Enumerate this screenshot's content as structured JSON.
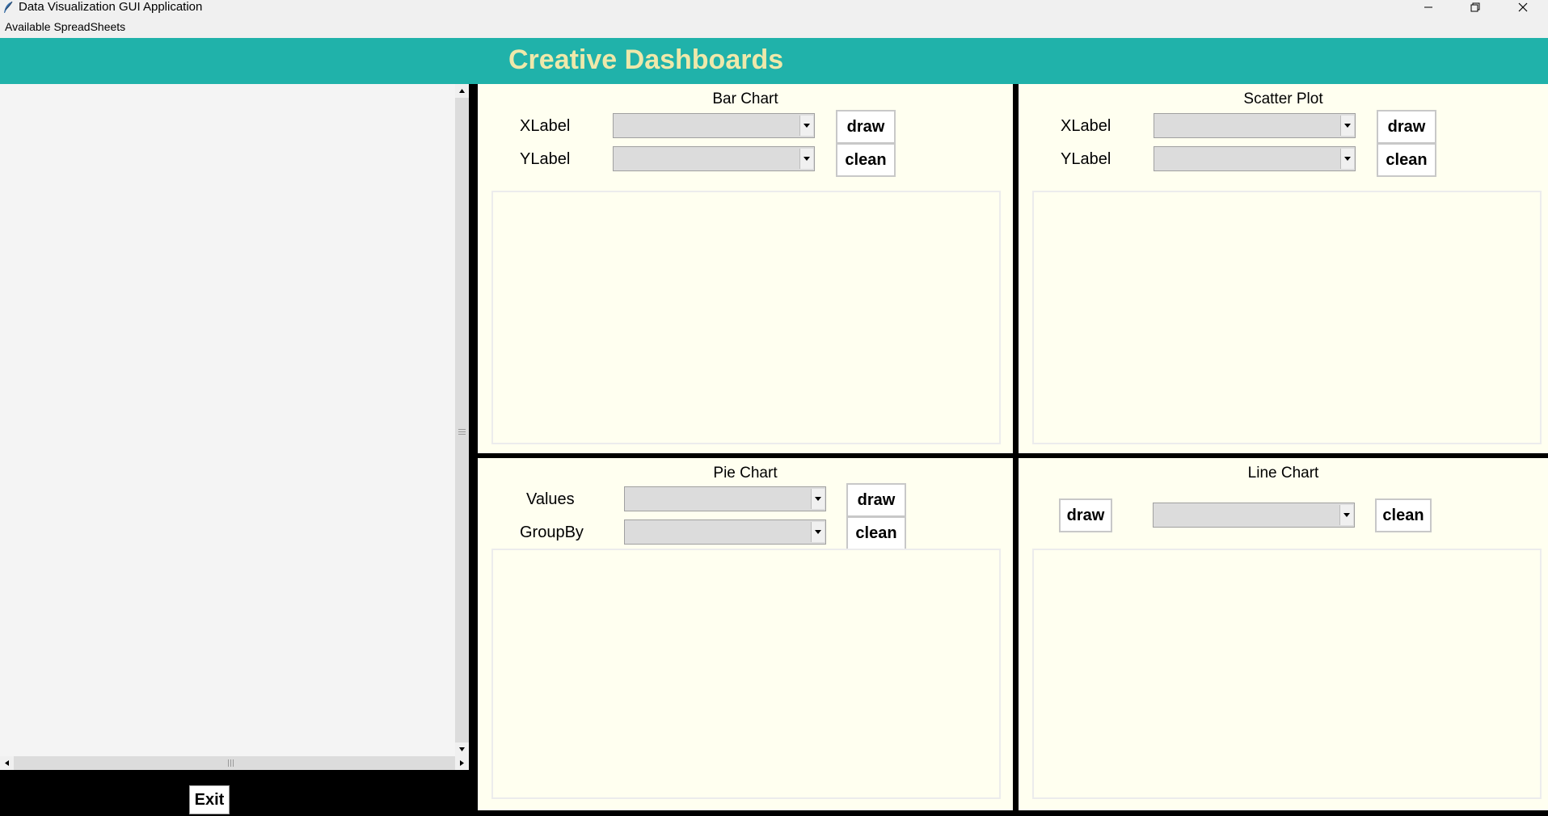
{
  "window": {
    "title": "Data Visualization GUI Application"
  },
  "menu": {
    "items": [
      "Available SpreadSheets"
    ]
  },
  "header": {
    "title": "Creative Dashboards"
  },
  "sidebar": {
    "exit_label": "Exit"
  },
  "panels": {
    "bar": {
      "title": "Bar Chart",
      "xlabel": "XLabel",
      "ylabel": "YLabel",
      "xlabel_value": "",
      "ylabel_value": "",
      "draw_label": "draw",
      "clean_label": "clean"
    },
    "scatter": {
      "title": "Scatter Plot",
      "xlabel": "XLabel",
      "ylabel": "YLabel",
      "xlabel_value": "",
      "ylabel_value": "",
      "draw_label": "draw",
      "clean_label": "clean"
    },
    "pie": {
      "title": "Pie Chart",
      "values_label": "Values",
      "groupby_label": "GroupBy",
      "values_value": "",
      "groupby_value": "",
      "draw_label": "draw",
      "clean_label": "clean"
    },
    "line": {
      "title": "Line Chart",
      "column_value": "",
      "draw_label": "draw",
      "clean_label": "clean"
    }
  },
  "colors": {
    "header_bg": "#20b2aa",
    "header_text": "#eee8aa",
    "panel_bg": "#fffff0",
    "separator": "#000000"
  },
  "icons": {
    "app": "feather-icon",
    "minimize": "minimize-icon",
    "restore": "restore-icon",
    "close": "close-icon"
  }
}
